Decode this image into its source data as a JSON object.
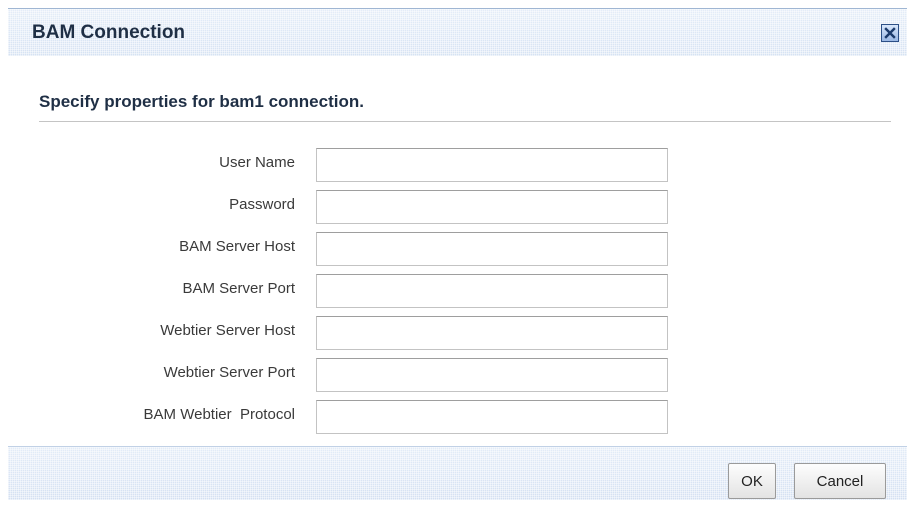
{
  "dialog": {
    "title": "BAM Connection",
    "close_icon": "close-icon",
    "heading": "Specify properties for bam1 connection."
  },
  "form": {
    "fields": [
      {
        "label": "User Name",
        "value": ""
      },
      {
        "label": "Password",
        "value": ""
      },
      {
        "label": "BAM Server Host",
        "value": ""
      },
      {
        "label": "BAM Server Port",
        "value": ""
      },
      {
        "label": "Webtier Server Host",
        "value": ""
      },
      {
        "label": "Webtier Server Port",
        "value": ""
      },
      {
        "label": "BAM Webtier  Protocol",
        "value": ""
      }
    ]
  },
  "footer": {
    "ok_label": "OK",
    "cancel_label": "Cancel"
  },
  "colors": {
    "title_text": "#1f2f45",
    "titlebar_bg": "#dfe9f6",
    "close_border": "#2c4f86"
  }
}
